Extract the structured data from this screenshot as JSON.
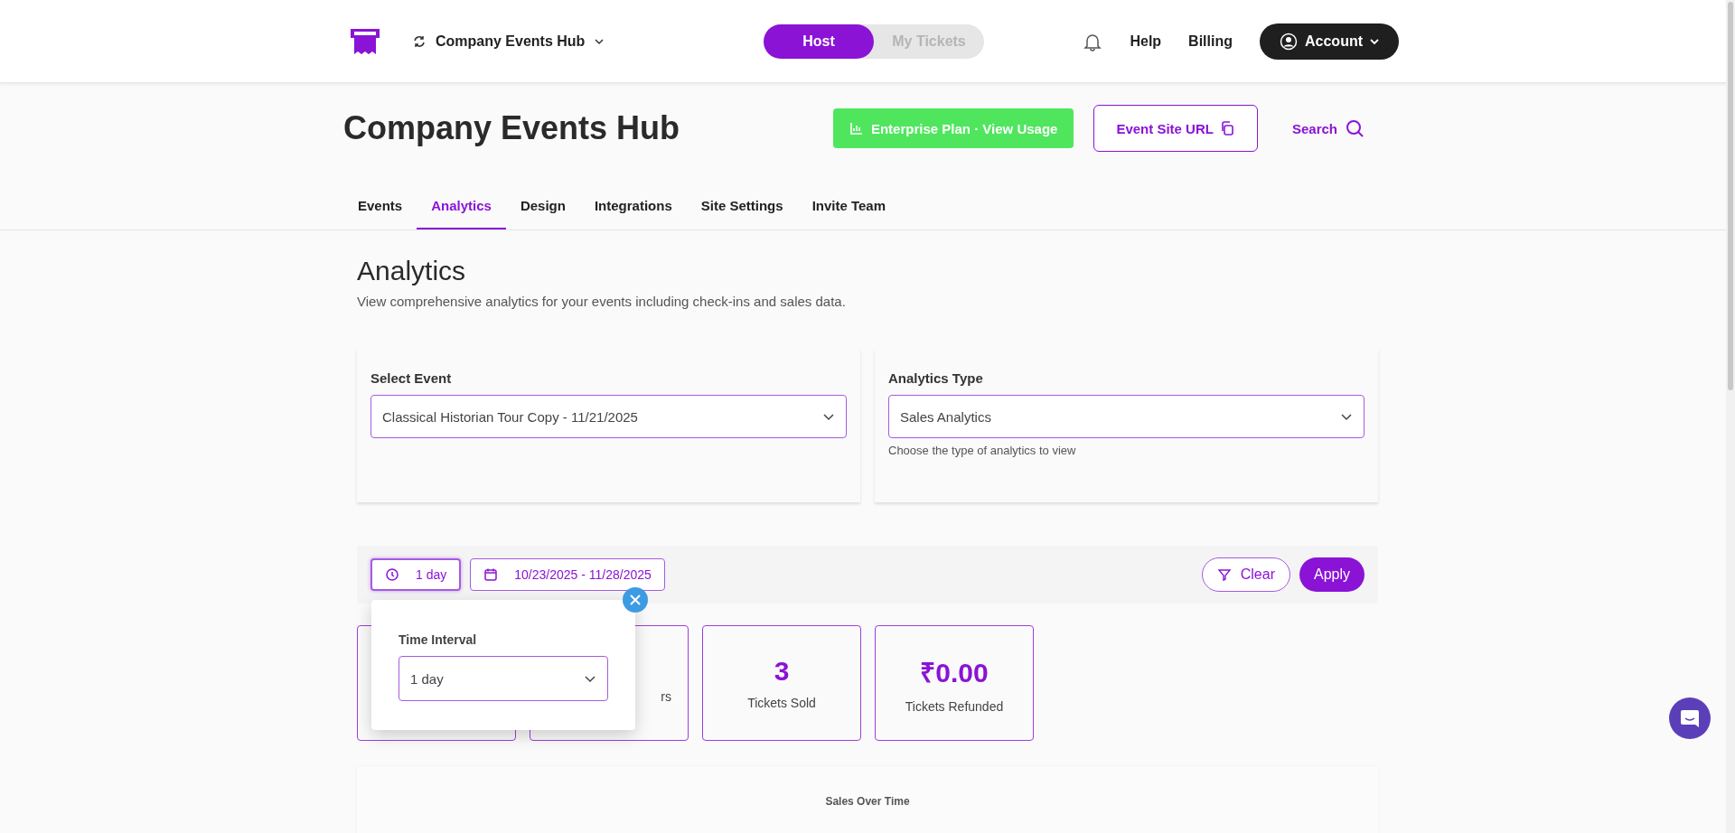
{
  "header": {
    "workspace": "Company Events Hub",
    "mode_toggle": [
      {
        "label": "Host",
        "selected": true
      },
      {
        "label": "My Tickets",
        "selected": false
      }
    ],
    "links": [
      "Help",
      "Billing"
    ],
    "account": "Account"
  },
  "page": {
    "title": "Company Events Hub",
    "plan_button": "Enterprise Plan · View Usage",
    "site_url_button": "Event Site URL",
    "search": "Search"
  },
  "tabs": [
    {
      "label": "Events",
      "selected": false
    },
    {
      "label": "Analytics",
      "selected": true
    },
    {
      "label": "Design",
      "selected": false
    },
    {
      "label": "Integrations",
      "selected": false
    },
    {
      "label": "Site Settings",
      "selected": false
    },
    {
      "label": "Invite Team",
      "selected": false
    }
  ],
  "section": {
    "title": "Analytics",
    "description": "View comprehensive analytics for your events including check-ins and sales data."
  },
  "selectors": [
    {
      "label": "Select Event",
      "value": "Classical Historian Tour Copy - 11/21/2025"
    },
    {
      "label": "Analytics Type",
      "value": "Sales Analytics",
      "hint": "Choose the type of analytics to view"
    }
  ],
  "filters": {
    "interval": "1 day",
    "date_range": "10/23/2025 - 11/28/2025",
    "clear": "Clear",
    "apply": "Apply"
  },
  "popover": {
    "label": "Time Interval",
    "value": "1 day"
  },
  "stat_cards": [
    {
      "kind": "covered"
    },
    {
      "kind": "partial",
      "label": "rs"
    },
    {
      "kind": "full",
      "value": "3",
      "label": "Tickets Sold"
    },
    {
      "kind": "full",
      "value": "₹0.00",
      "label": "Tickets Refunded"
    }
  ],
  "chart": {
    "title": "Sales Over Time"
  }
}
